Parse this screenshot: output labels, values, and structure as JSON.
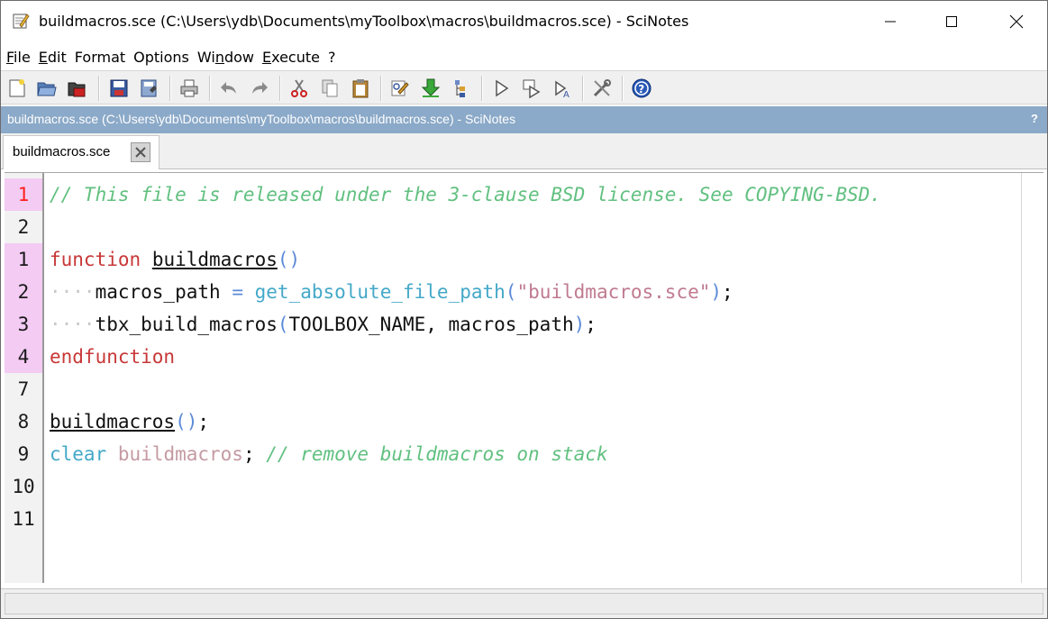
{
  "window": {
    "title": "buildmacros.sce (C:\\Users\\ydb\\Documents\\myToolbox\\macros\\buildmacros.sce) - SciNotes"
  },
  "menu": {
    "items": [
      {
        "label": "File",
        "accel": "F",
        "rest": "ile"
      },
      {
        "label": "Edit",
        "accel": "E",
        "rest": "dit"
      },
      {
        "label": "Format",
        "accel": "",
        "rest": "Format"
      },
      {
        "label": "Options",
        "accel": "",
        "rest": "Options"
      },
      {
        "label": "Window",
        "pre": "Wi",
        "accel": "n",
        "rest": "dow"
      },
      {
        "label": "Execute",
        "accel": "E",
        "rest": "xecute"
      },
      {
        "label": "?",
        "accel": "",
        "rest": "?"
      }
    ]
  },
  "infobar": {
    "text": "buildmacros.sce (C:\\Users\\ydb\\Documents\\myToolbox\\macros\\buildmacros.sce) - SciNotes",
    "help": "?"
  },
  "tab": {
    "label": "buildmacros.sce"
  },
  "editor": {
    "line_numbers": [
      "1",
      "2",
      "1",
      "2",
      "3",
      "4",
      "7",
      "8",
      "9",
      "10",
      "11"
    ],
    "lines": {
      "l1": {
        "comment": "// This file is released under the 3-clause BSD license. See COPYING-BSD."
      },
      "l3": {
        "kw": "function",
        "name": "buildmacros",
        "paren": "()"
      },
      "l4": {
        "var": "macros_path",
        "op": "=",
        "fn": "get_absolute_file_path",
        "open": "(",
        "str": "\"buildmacros.sce\"",
        "close": ")",
        "semi": ";"
      },
      "l5": {
        "fn": "tbx_build_macros",
        "open": "(",
        "args": "TOOLBOX_NAME, macros_path",
        "close": ")",
        "semi": ";"
      },
      "l6": {
        "kw": "endfunction"
      },
      "l8": {
        "name": "buildmacros",
        "paren": "()",
        "semi": ";"
      },
      "l9": {
        "cmd": "clear",
        "var": "buildmacros",
        "semi": ";",
        "comment": "// remove buildmacros on stack"
      }
    }
  },
  "colors": {
    "infobar": "#8ba9c8",
    "breakpoint_gutter": "#f3cbf3",
    "comment": "#61c080",
    "keyword": "#c83737"
  }
}
